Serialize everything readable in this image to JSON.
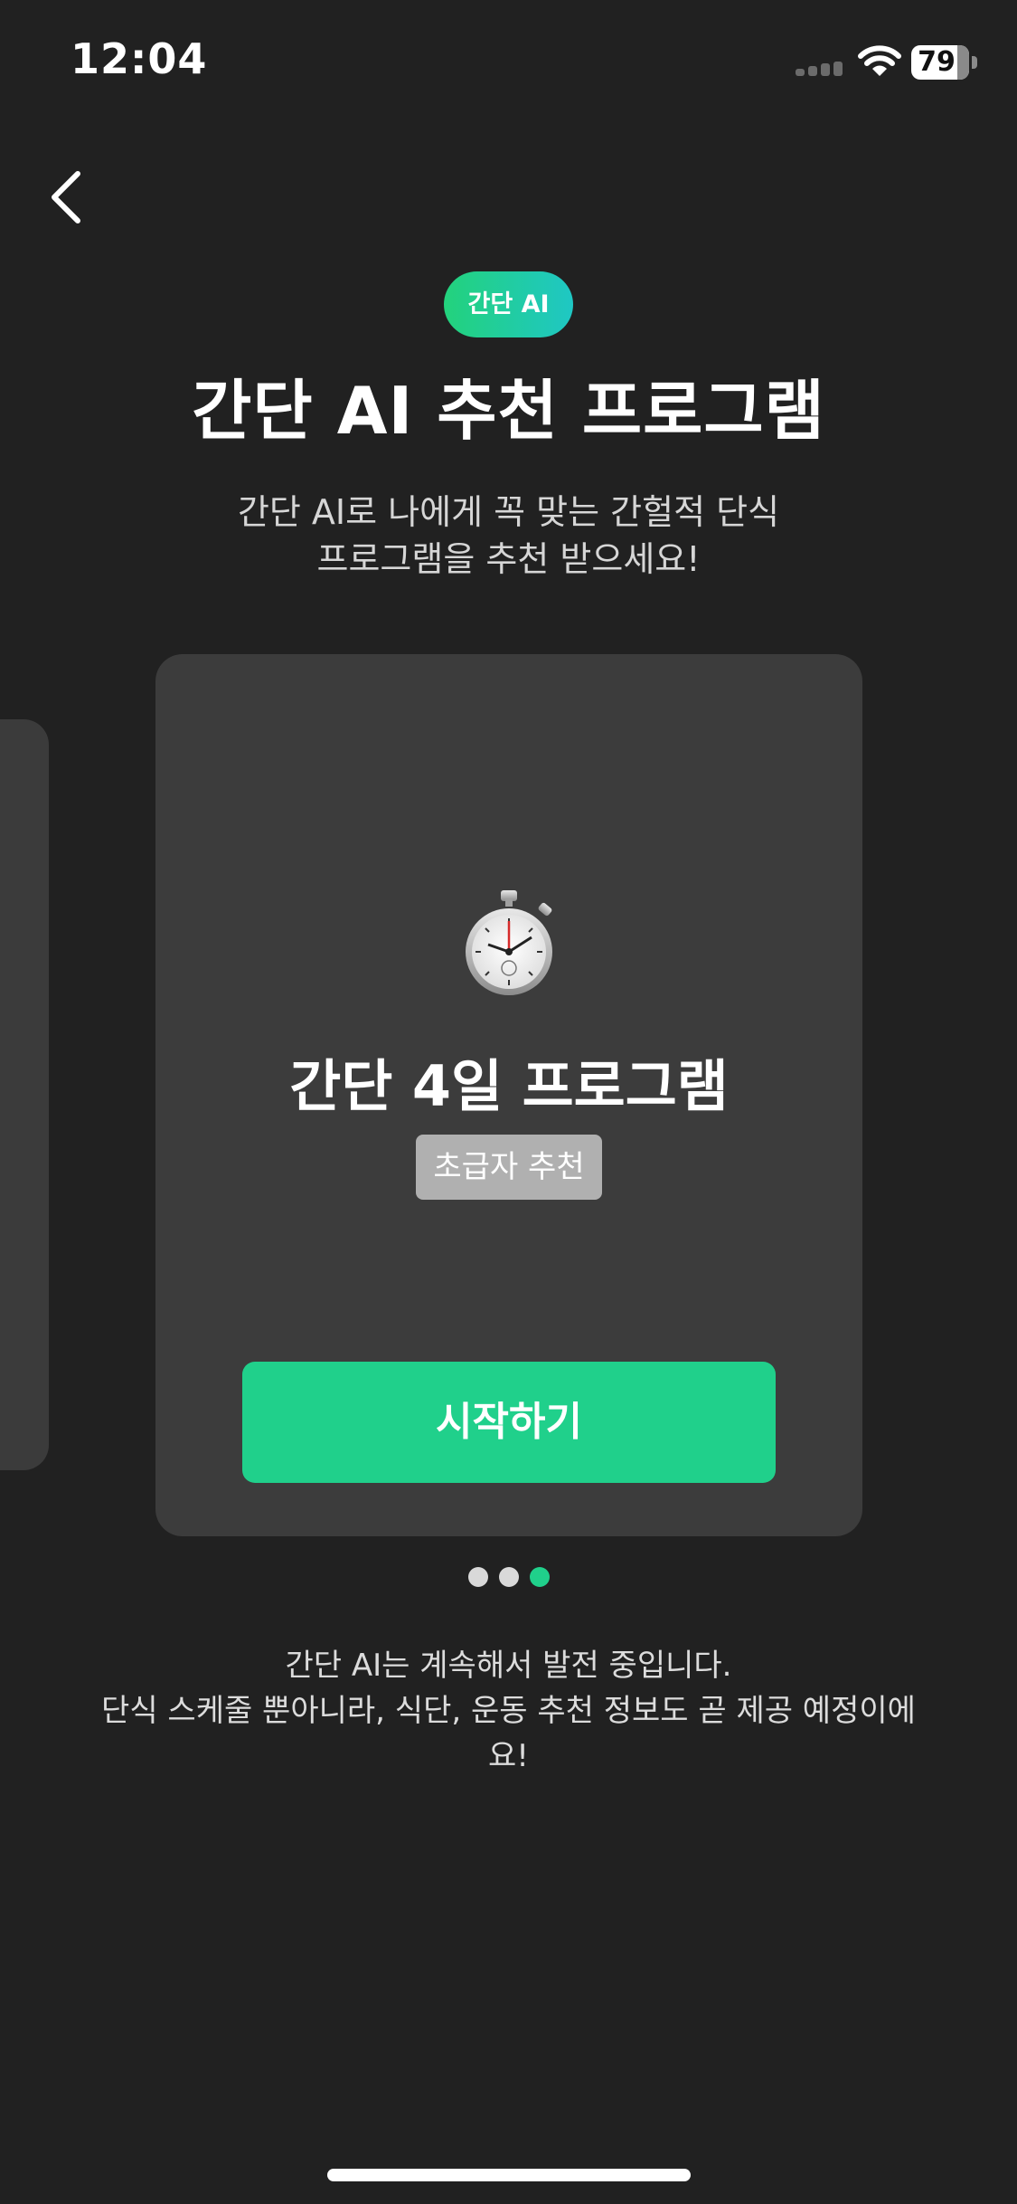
{
  "status_bar": {
    "time": "12:04",
    "battery_level": "79",
    "battery_fraction": 0.79,
    "icons": [
      "cellular-signal-icon",
      "wifi-icon",
      "battery-icon"
    ]
  },
  "nav": {
    "back_icon": "chevron-left-icon"
  },
  "header": {
    "badge": "간단 AI",
    "title": "간단 AI 추천 프로그램",
    "subtitle_lines": [
      "간단 AI로 나에게 꼭 맞는 간헐적 단식",
      "프로그램을 추천 받으세요!"
    ]
  },
  "card": {
    "icon": "stopwatch-icon",
    "title": "간단 4일 프로그램",
    "tag": "초급자 추천",
    "button_label": "시작하기"
  },
  "pagination": {
    "total": 3,
    "active_index": 2
  },
  "footer": {
    "lines": [
      "간단 AI는 계속해서 발전 중입니다.",
      "단식 스케줄 뿐아니라, 식단, 운동 추천 정보도 곧 제공 예정이에",
      "요!"
    ]
  },
  "colors": {
    "background": "#212121",
    "card": "#3c3c3c",
    "accent": "#20d08b",
    "badge_gradient_end": "#1fc7c4",
    "tag": "#b0b0b0",
    "dot_inactive": "#d9d9d9"
  }
}
